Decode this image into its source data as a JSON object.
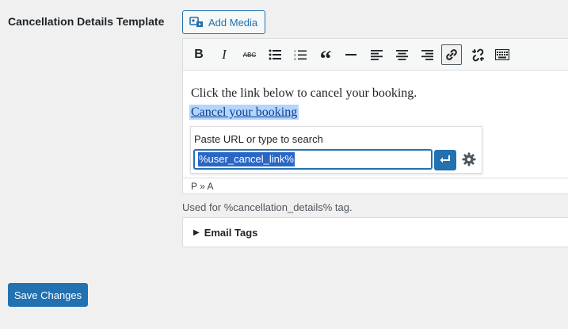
{
  "field": {
    "label": "Cancellation Details Template"
  },
  "media": {
    "add_label": "Add Media"
  },
  "toolbar": {
    "icons": [
      "bold-icon",
      "italic-icon",
      "strikethrough-icon",
      "bullet-list-icon",
      "numbered-list-icon",
      "blockquote-icon",
      "horizontal-line-icon",
      "align-left-icon",
      "align-center-icon",
      "align-right-icon",
      "insert-link-icon",
      "unlink-icon",
      "toolbar-toggle-icon"
    ],
    "bold": "B",
    "italic": "I",
    "strike": "ABC",
    "quote": "“"
  },
  "editor": {
    "line1": "Click the link below to cancel your booking.",
    "link_text": "Cancel your booking",
    "link_popup": {
      "hint": "Paste URL or type to search",
      "url_value": "%user_cancel_link%"
    },
    "status_path": "P » A"
  },
  "help_text": "Used for %cancellation_details% tag.",
  "email_tags": {
    "label": "Email Tags",
    "toggle": "▶"
  },
  "save_button": "Save Changes",
  "colors": {
    "accent": "#2271b1",
    "selection": "#b4d5fe",
    "background": "#f0f0f1"
  }
}
